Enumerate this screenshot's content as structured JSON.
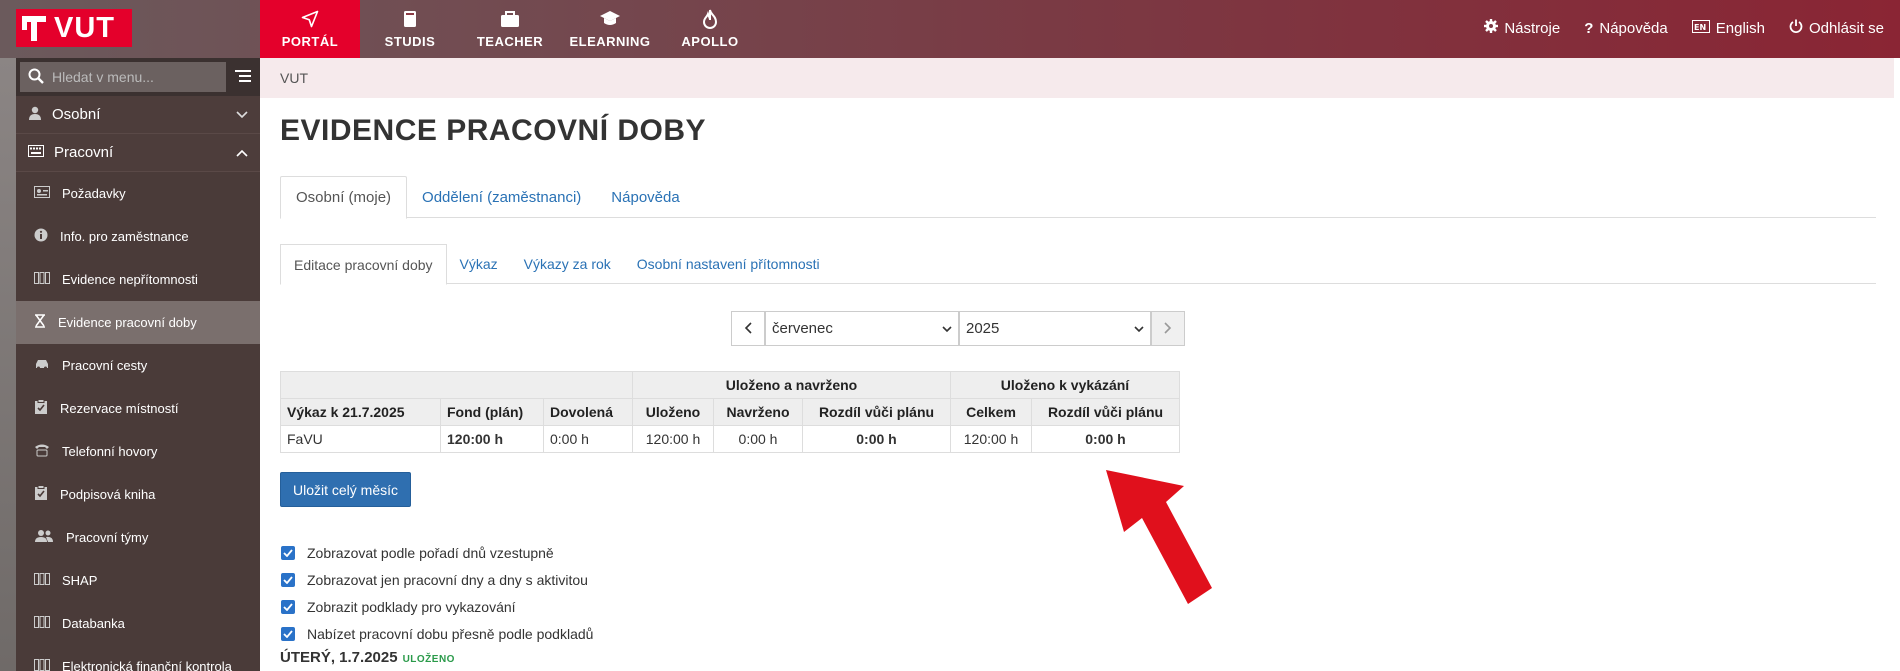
{
  "brand": {
    "logo_text": "VUT"
  },
  "nav": {
    "items": [
      {
        "label": "PORTÁL",
        "icon": "send-icon",
        "active": true
      },
      {
        "label": "STUDIS",
        "icon": "book-icon"
      },
      {
        "label": "TEACHER",
        "icon": "briefcase-icon"
      },
      {
        "label": "ELEARNING",
        "icon": "graduation-cap-icon"
      },
      {
        "label": "APOLLO",
        "icon": "flame-icon"
      }
    ]
  },
  "topright": {
    "tools": "Nástroje",
    "help": "Nápověda",
    "lang": "English",
    "logout": "Odhlásit se"
  },
  "sidebar": {
    "search_placeholder": "Hledat v menu...",
    "sections": [
      {
        "label": "Osobní",
        "expanded": false
      },
      {
        "label": "Pracovní",
        "expanded": true
      }
    ],
    "items": [
      {
        "label": "Požadavky",
        "icon": "id-card-icon"
      },
      {
        "label": "Info. pro zaměstnance",
        "icon": "info-icon"
      },
      {
        "label": "Evidence nepřítomnosti",
        "icon": "columns-icon"
      },
      {
        "label": "Evidence pracovní doby",
        "icon": "hourglass-icon",
        "active": true
      },
      {
        "label": "Pracovní cesty",
        "icon": "car-icon"
      },
      {
        "label": "Rezervace místností",
        "icon": "clipboard-check-icon"
      },
      {
        "label": "Telefonní hovory",
        "icon": "phone-icon"
      },
      {
        "label": "Podpisová kniha",
        "icon": "clipboard-check-icon"
      },
      {
        "label": "Pracovní týmy",
        "icon": "users-icon"
      },
      {
        "label": "SHAP",
        "icon": "columns-icon"
      },
      {
        "label": "Databanka",
        "icon": "columns-icon"
      },
      {
        "label": "Elektronická finanční kontrola",
        "icon": "columns-icon"
      }
    ]
  },
  "breadcrumb": "VUT",
  "page_title": "EVIDENCE PRACOVNÍ DOBY",
  "tabs": [
    "Osobní (moje)",
    "Oddělení (zaměstnanci)",
    "Nápověda"
  ],
  "subtabs": [
    "Editace pracovní doby",
    "Výkaz",
    "Výkazy za rok",
    "Osobní nastavení přítomnosti"
  ],
  "month_nav": {
    "month": "červenec",
    "year": "2025"
  },
  "summary": {
    "group1": "Uloženo a navrženo",
    "group2": "Uloženo k vykázání",
    "headers": [
      "Výkaz k 21.7.2025",
      "Fond (plán)",
      "Dovolená",
      "Uloženo",
      "Navrženo",
      "Rozdíl vůči plánu",
      "Celkem",
      "Rozdíl vůči plánu"
    ],
    "row": [
      "FaVU",
      "120:00 h",
      "0:00 h",
      "120:00 h",
      "0:00 h",
      "0:00 h",
      "120:00 h",
      "0:00 h"
    ]
  },
  "save_button": "Uložit celý měsíc",
  "options": [
    "Zobrazovat podle pořadí dnů vzestupně",
    "Zobrazovat jen pracovní dny a dny s aktivitou",
    "Zobrazit podklady pro vykazování",
    "Nabízet pracovní dobu přesně podle podkladů"
  ],
  "day": {
    "title": "ÚTERÝ, 1.7.2025",
    "status": "ULOŽENO"
  },
  "colors": {
    "accent": "#e4002b",
    "link": "#2a72b5",
    "button": "#2f6fb0",
    "status_ok": "#2a9a4a"
  }
}
